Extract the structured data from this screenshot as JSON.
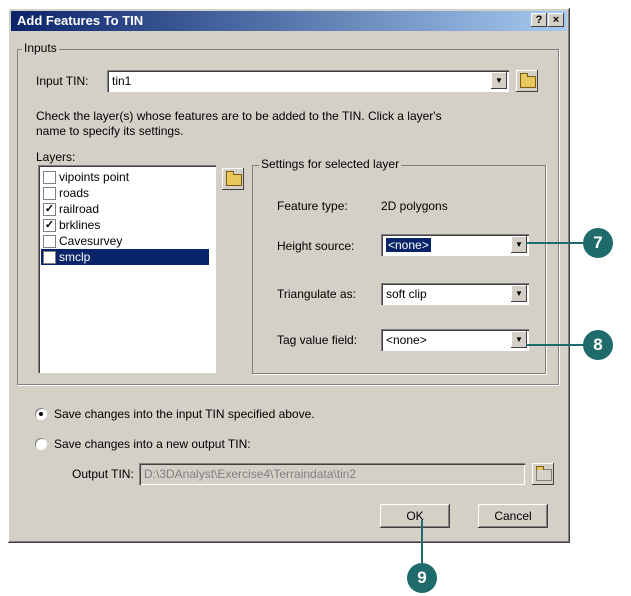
{
  "window": {
    "title": "Add Features To TIN",
    "help_btn": "?",
    "close_btn": "×"
  },
  "inputs": {
    "group_label": "Inputs",
    "input_tin_label": "Input TIN:",
    "input_tin_value": "tin1",
    "instructions": "Check the layer(s) whose features are to be added to the TIN. Click a layer's name to specify its settings.",
    "instructions_line1": "Check the layer(s) whose features are to be added to the TIN. Click a layer's",
    "instructions_line2": "name to specify its settings.",
    "layers_label": "Layers:",
    "layers": [
      {
        "label": "vipoints point",
        "checked": false,
        "mark": ""
      },
      {
        "label": "roads",
        "checked": false,
        "mark": ""
      },
      {
        "label": "railroad",
        "checked": true,
        "mark": "✓"
      },
      {
        "label": "brklines",
        "checked": true,
        "mark": "✓"
      },
      {
        "label": "Cavesurvey",
        "checked": false,
        "mark": ""
      },
      {
        "label": "smclp",
        "checked": true,
        "mark": "✓",
        "selected": true
      }
    ]
  },
  "settings": {
    "group_label": "Settings for selected layer",
    "feature_type_label": "Feature type:",
    "feature_type_value": "2D polygons",
    "height_source_label": "Height source:",
    "height_source_value": "<none>",
    "triangulate_label": "Triangulate as:",
    "triangulate_value": "soft clip",
    "tag_value_label": "Tag value field:",
    "tag_value_value": "<none>"
  },
  "save": {
    "option1": "Save changes into the input TIN specified above.",
    "option2": "Save changes into a new output TIN:",
    "selected": 1,
    "output_tin_label": "Output TIN:",
    "output_tin_value": "D:\\3DAnalyst\\Exercise4\\Terraindata\\tin2"
  },
  "buttons": {
    "ok": "OK",
    "cancel": "Cancel"
  },
  "callouts": {
    "c7": "7",
    "c8": "8",
    "c9": "9"
  },
  "colors": {
    "title_start": "#0a246a",
    "title_end": "#a6caf0",
    "selection": "#0a246a",
    "callout": "#1f6b6b",
    "dialog_bg": "#d4d0c8"
  }
}
